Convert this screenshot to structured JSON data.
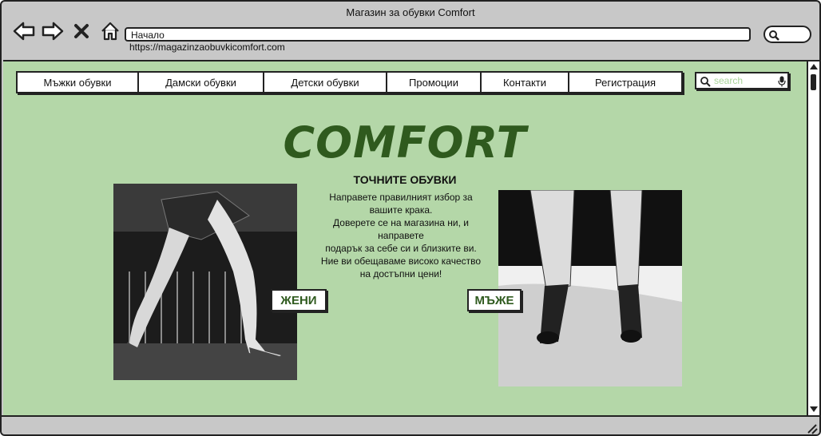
{
  "window": {
    "title": "Магазин за обувки Comfort"
  },
  "browser": {
    "address": "Начало",
    "url": "https://magazinzaobuvkicomfort.com"
  },
  "menu": {
    "items": [
      {
        "label": "Мъжки обувки"
      },
      {
        "label": "Дамски обувки"
      },
      {
        "label": "Детски обувки"
      },
      {
        "label": "Промоции"
      },
      {
        "label": "Контакти"
      },
      {
        "label": "Регистрация"
      }
    ]
  },
  "search": {
    "placeholder": "search"
  },
  "hero": {
    "brand": "COMFORT",
    "tagline": "ТОЧНИТЕ ОБУВКИ",
    "description_lines": [
      "Направете правилният избор за",
      "вашите крака.",
      "Доверете се на магазина ни, и",
      "направете",
      "подарък за себе си и близките ви.",
      "Ние ви обещаваме високо качество",
      "на достъпни цени!"
    ]
  },
  "buttons": {
    "women": "ЖЕНИ",
    "men": "МЪЖЕ"
  },
  "colors": {
    "page_bg": "#b4d7a8",
    "brand": "#2f5a1e",
    "chrome": "#c8c8c8",
    "placeholder": "#a9d49a"
  },
  "icons": [
    "back-arrow-icon",
    "forward-arrow-icon",
    "close-icon",
    "home-icon",
    "search-icon",
    "microphone-icon",
    "resize-grip-icon"
  ]
}
